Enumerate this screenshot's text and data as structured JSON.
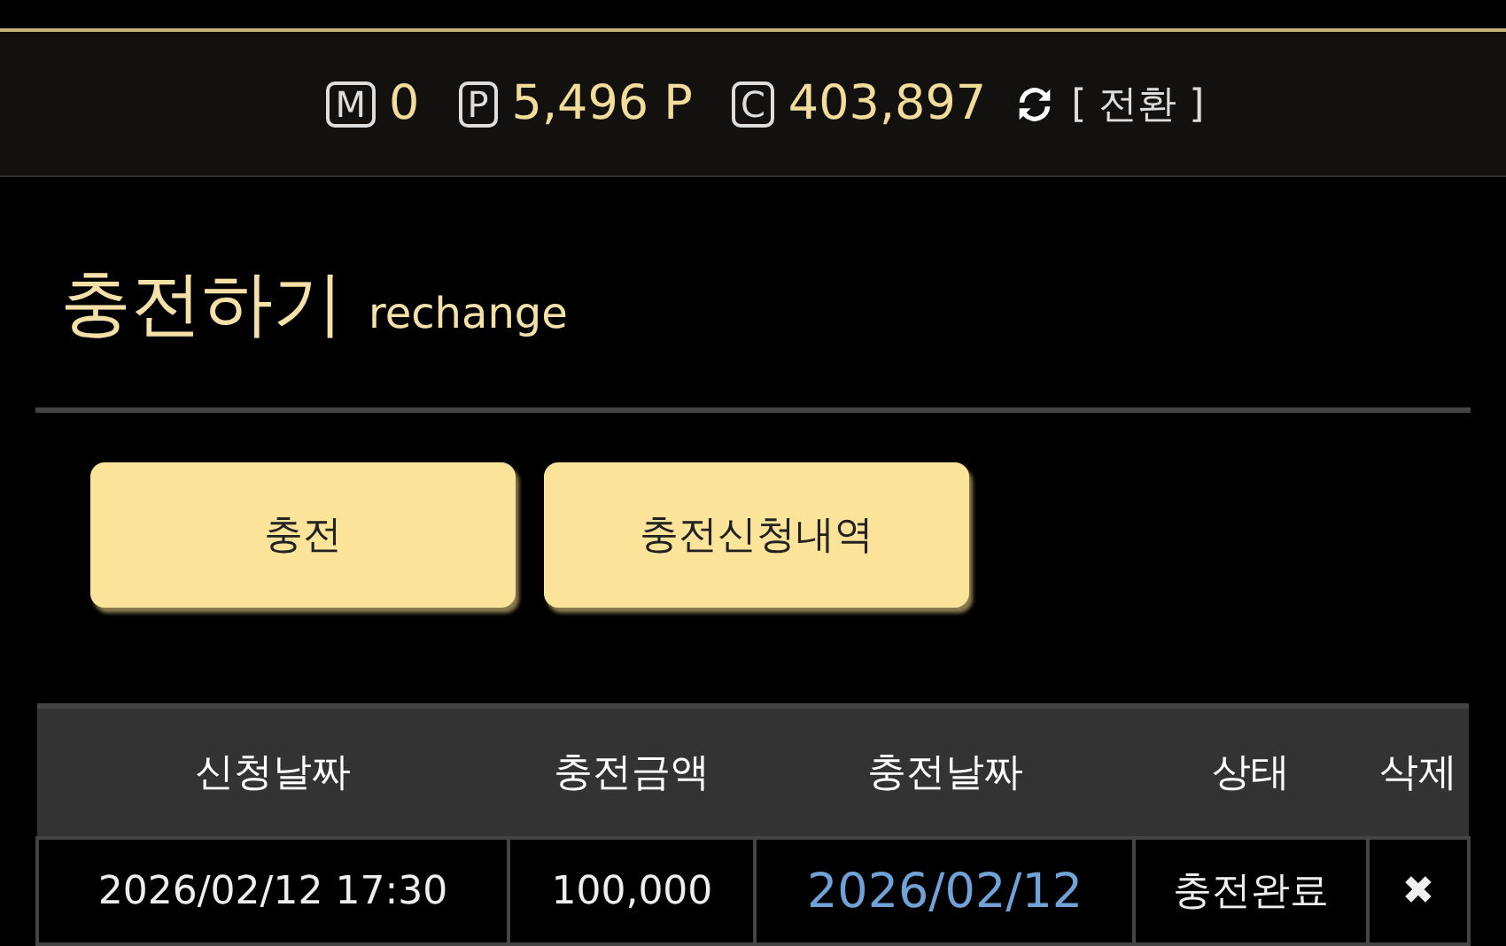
{
  "balances": [
    {
      "badge": "M",
      "amount": "0"
    },
    {
      "badge": "P",
      "amount": "5,496 P"
    },
    {
      "badge": "C",
      "amount": "403,897"
    }
  ],
  "switch_label": "[ 전환 ]",
  "title": "충전하기",
  "subtitle": "rechange",
  "buttons": [
    "충전",
    "충전신청내역"
  ],
  "table": {
    "columns": [
      "신청날짜",
      "충전금액",
      "충전날짜",
      "상태",
      "삭제"
    ],
    "rows": [
      {
        "cells": [
          "2026/02/12 17:30",
          "100,000",
          "2026/02/12",
          "충전완료",
          "✖"
        ]
      }
    ]
  }
}
